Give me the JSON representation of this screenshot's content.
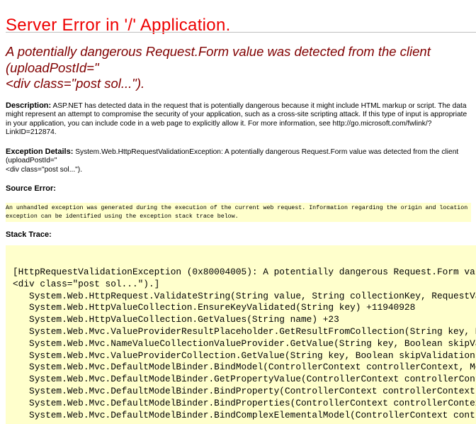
{
  "title": "Server Error in '/' Application.",
  "subtitle": [
    "A potentially dangerous Request.Form value was detected from the client",
    "(uploadPostId=\"",
    "<div class=\"post sol...\")."
  ],
  "description": {
    "label": "Description:",
    "text": "ASP.NET has detected data in the request that is potentially dangerous because it might include HTML markup or script. The data might represent an attempt to compromise the security of your application, such as a cross-site scripting attack. If this type of input is appropriate in your application, you can include code in a web page to explicitly allow it. For more information, see http://go.microsoft.com/fwlink/?LinkID=212874."
  },
  "exception_details": {
    "label": "Exception Details:",
    "lines": [
      "System.Web.HttpRequestValidationException: A potentially dangerous Request.Form value was detected from the client (uploadPostId=\"",
      "<div class=\"post sol...\")."
    ]
  },
  "source_error": {
    "label": "Source Error:",
    "lines": [
      "An unhandled exception was generated during the execution of the current web request. Information regarding the origin and location of the",
      "exception can be identified using the exception stack trace below."
    ]
  },
  "stack_trace": {
    "label": "Stack Trace:",
    "lines": [
      "[HttpRequestValidationException (0x80004005): A potentially dangerous Request.Form valu",
      "<div class=\"post sol...\").]",
      "   System.Web.HttpRequest.ValidateString(String value, String collectionKey, RequestVal",
      "   System.Web.HttpValueCollection.EnsureKeyValidated(String key) +11940928",
      "   System.Web.HttpValueCollection.GetValues(String name) +23",
      "   System.Web.Mvc.ValueProviderResultPlaceholder.GetResultFromCollection(String key, Na",
      "   System.Web.Mvc.NameValueCollectionValueProvider.GetValue(String key, Boolean skipVal",
      "   System.Web.Mvc.ValueProviderCollection.GetValue(String key, Boolean skipValidation)",
      "   System.Web.Mvc.DefaultModelBinder.BindModel(ControllerContext controllerContext, Mod",
      "   System.Web.Mvc.DefaultModelBinder.GetPropertyValue(ControllerContext controllerConte",
      "   System.Web.Mvc.DefaultModelBinder.BindProperty(ControllerContext controllerContext,",
      "   System.Web.Mvc.DefaultModelBinder.BindProperties(ControllerContext controllerContext",
      "   System.Web.Mvc.DefaultModelBinder.BindComplexElementalModel(ControllerContext contro"
    ]
  }
}
